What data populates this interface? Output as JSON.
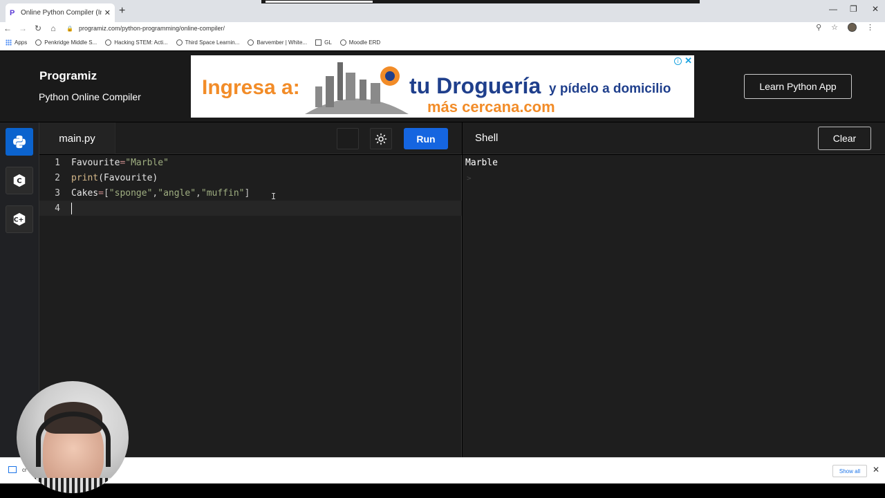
{
  "browser": {
    "tab_title": "Online Python Compiler (Interpr",
    "url": "programiz.com/python-programming/online-compiler/",
    "bookmarks": [
      "Apps",
      "Penkridge Middle S...",
      "Hacking STEM: Acti...",
      "Third Space Learnin...",
      "Barvember | White...",
      "GL",
      "Moodle ERD"
    ]
  },
  "header": {
    "logo": "Programiz",
    "subtitle": "Python Online Compiler",
    "learn_button": "Learn Python App"
  },
  "ad": {
    "line1": "Ingresa a:",
    "line2": "tu Droguería",
    "line3": "y pídelo a domicilio",
    "line4": "más cercana.com"
  },
  "editor": {
    "file_tab": "main.py",
    "run_label": "Run",
    "lines": [
      {
        "num": "1",
        "parts": [
          "Favourite",
          "=",
          "\"Marble\""
        ]
      },
      {
        "num": "2",
        "parts": [
          "print",
          "(Favourite)"
        ]
      },
      {
        "num": "3",
        "parts": [
          "Cakes",
          "=",
          "[",
          "\"sponge\"",
          ",",
          "\"angle\"",
          ",",
          "\"muffin\"",
          "]"
        ]
      },
      {
        "num": "4",
        "parts": []
      }
    ]
  },
  "shell": {
    "title": "Shell",
    "clear_label": "Clear",
    "output": "Marble",
    "prompt": ">"
  },
  "downloads": {
    "item": "cr",
    "show_all": "Show all"
  },
  "colors": {
    "accent": "#1565e0",
    "string": "#9fae81",
    "function": "#d6b98a",
    "operator": "#c98b8b"
  }
}
